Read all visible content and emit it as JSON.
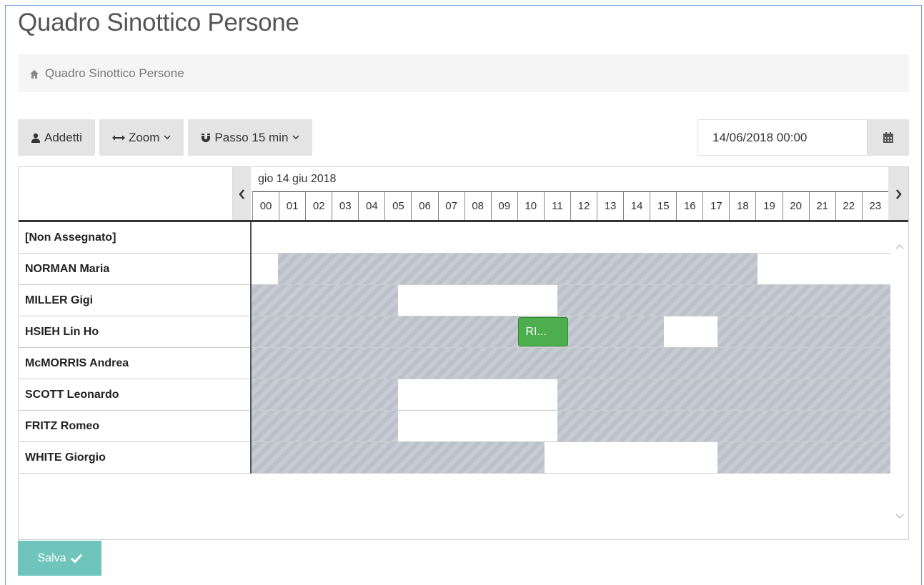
{
  "page": {
    "title": "Quadro Sinottico Persone"
  },
  "breadcrumb": {
    "label": "Quadro Sinottico Persone"
  },
  "toolbar": {
    "addetti_label": "Addetti",
    "zoom_label": "Zoom",
    "passo_label": "Passo 15 min"
  },
  "date_picker": {
    "value": "14/06/2018 00:00"
  },
  "timeline": {
    "date_label": "gio 14 giu 2018",
    "hours": [
      "00",
      "01",
      "02",
      "03",
      "04",
      "05",
      "06",
      "07",
      "08",
      "09",
      "10",
      "11",
      "12",
      "13",
      "14",
      "15",
      "16",
      "17",
      "18",
      "19",
      "20",
      "21",
      "22",
      "23"
    ]
  },
  "rows": [
    {
      "name": "[Non Assegnato]",
      "busy": []
    },
    {
      "name": "NORMAN Maria",
      "busy": [
        [
          1,
          19
        ]
      ]
    },
    {
      "name": "MILLER Gigi",
      "busy": [
        [
          0,
          5.5
        ],
        [
          11.5,
          24
        ]
      ]
    },
    {
      "name": "HSIEH Lin Ho",
      "busy": [
        [
          0,
          15.5
        ],
        [
          17.5,
          24
        ]
      ],
      "event": {
        "label": "RI...",
        "start": 10,
        "end": 11.9
      }
    },
    {
      "name": "McMORRIS Andrea",
      "busy": [
        [
          0,
          24
        ]
      ]
    },
    {
      "name": "SCOTT Leonardo",
      "busy": [
        [
          0,
          5.5
        ],
        [
          11.5,
          24
        ]
      ]
    },
    {
      "name": "FRITZ Romeo",
      "busy": [
        [
          0,
          5.5
        ],
        [
          11.5,
          24
        ]
      ]
    },
    {
      "name": "WHITE Giorgio",
      "busy": [
        [
          0,
          11
        ],
        [
          17.5,
          24
        ]
      ]
    }
  ],
  "save_button": {
    "label": "Salva"
  },
  "colors": {
    "busy": "#c1c6cf",
    "event": "#4cae4c",
    "save": "#6fc5bb"
  },
  "icons": [
    "home-icon",
    "user-icon",
    "arrows-horizontal-icon",
    "chevron-down-icon",
    "magnet-icon",
    "calendar-icon",
    "chevron-left-icon",
    "chevron-right-icon",
    "chevron-up-icon",
    "check-icon"
  ]
}
